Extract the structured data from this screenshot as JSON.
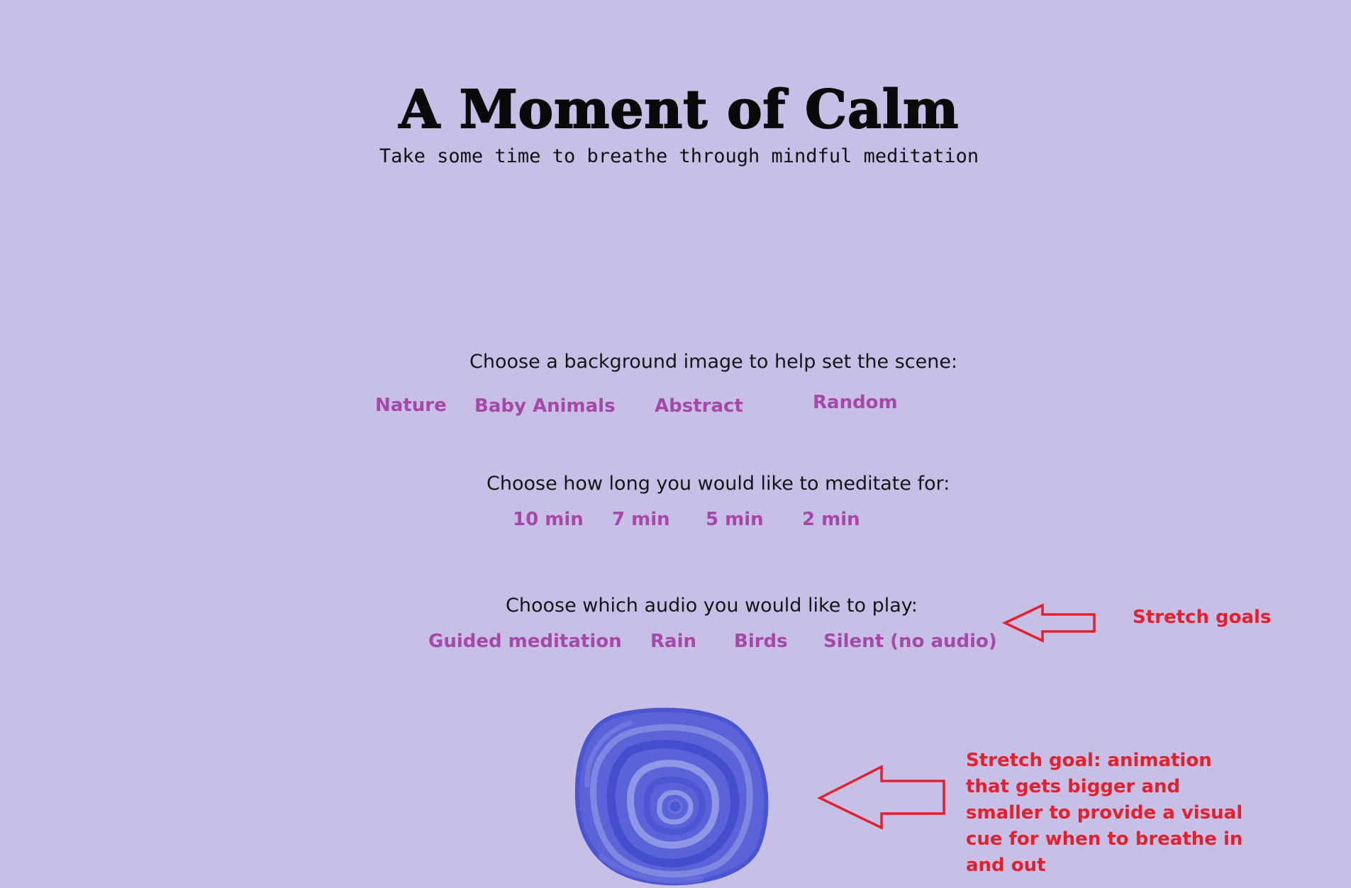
{
  "header": {
    "title": "A Moment of Calm",
    "subtitle": "Take some time to breathe through mindful meditation"
  },
  "background": {
    "prompt": "Choose a background image to help set the scene:",
    "options": [
      "Nature",
      "Baby Animals",
      "Abstract",
      "Random"
    ]
  },
  "duration": {
    "prompt": "Choose how long you would like to meditate for:",
    "options": [
      "10 min",
      "7 min",
      "5 min",
      "2 min"
    ]
  },
  "audio": {
    "prompt": "Choose which audio you would like to play:",
    "options": [
      "Guided meditation",
      "Rain",
      "Birds",
      "Silent (no audio)"
    ]
  },
  "annotations": {
    "stretch_goals": "Stretch goals",
    "animation_note": "Stretch goal: animation that gets bigger and smaller to provide a visual cue for when to breathe in and out"
  },
  "colors": {
    "background": "#c7bfe6",
    "option_text": "#a548a8",
    "annotation": "#e2202e",
    "breathing_circle": "#4c5ad6"
  }
}
